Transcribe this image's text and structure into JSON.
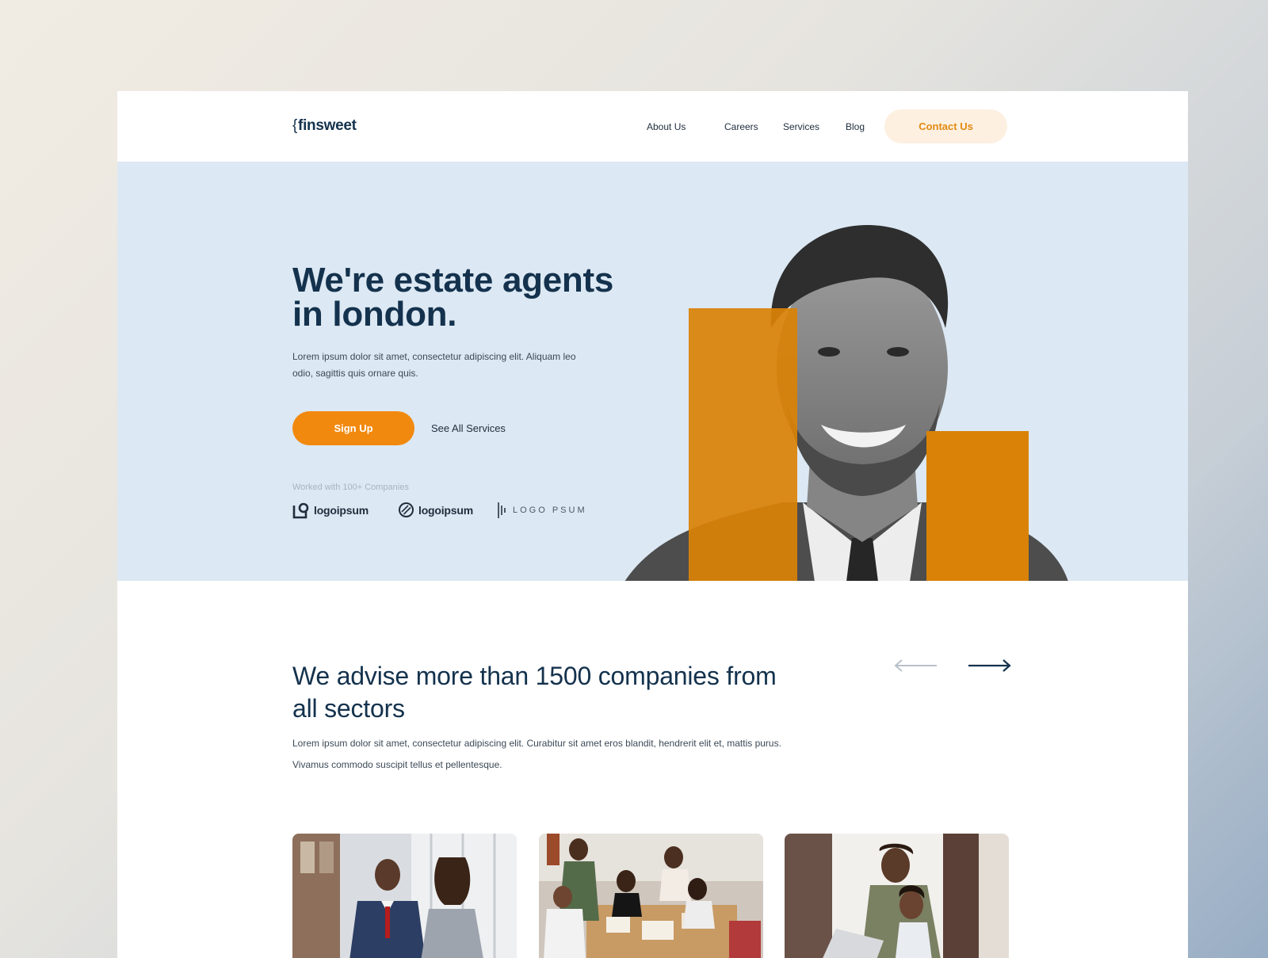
{
  "nav": {
    "logo_brace": "{",
    "logo_text": "finsweet",
    "links": [
      "About Us",
      "Careers",
      "Services",
      "Blog"
    ],
    "contact_label": "Contact Us"
  },
  "hero": {
    "title": "We're estate agents in london.",
    "subtitle": "Lorem ipsum dolor sit amet, consectetur adipiscing elit. Aliquam leo odio, sagittis quis ornare quis.",
    "signup_label": "Sign Up",
    "services_label": "See All Services",
    "worked_label": "Worked with 100+ Companies",
    "partners": [
      "logoipsum",
      "logoipsum",
      "LOGO PSUM"
    ]
  },
  "advise": {
    "title": "We advise more than 1500 companies from all sectors",
    "subtitle": "Lorem ipsum dolor sit amet, consectetur adipiscing elit. Curabitur sit amet eros blandit, hendrerit elit et, mattis purus. Vivamus commodo suscipit tellus et pellentesque.",
    "arrows": [
      "arrow-left-icon",
      "arrow-right-icon"
    ]
  },
  "colors": {
    "accent": "#f2890f",
    "navy": "#14324d",
    "hero_bg": "#dce8f3",
    "contact_bg": "#fdf0e1"
  }
}
